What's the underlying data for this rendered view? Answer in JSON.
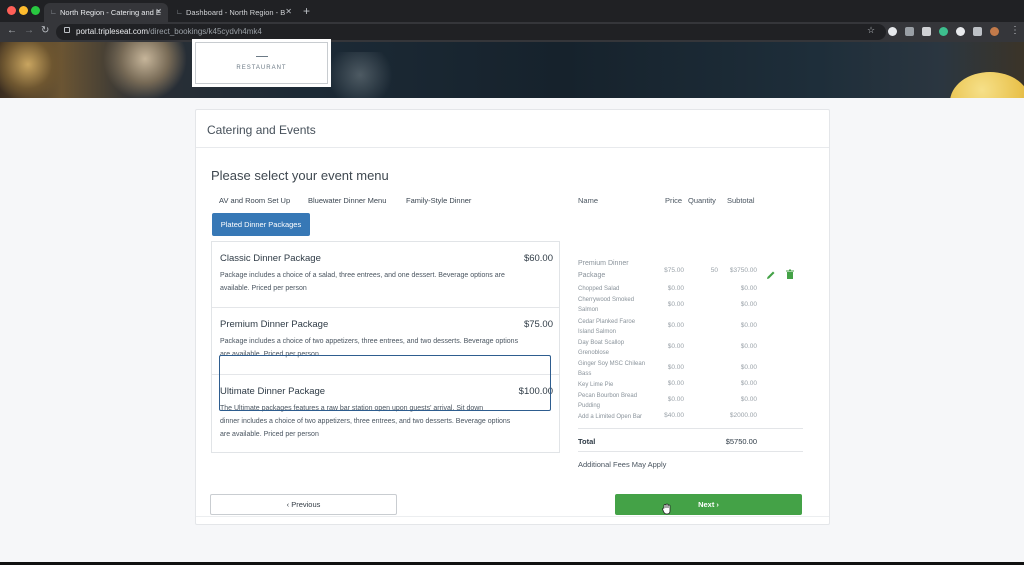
{
  "browser": {
    "tabs": [
      {
        "title": "North Region - Catering and E",
        "active": true
      },
      {
        "title": "Dashboard - North Region - B",
        "active": false
      }
    ],
    "new_tab": "+",
    "url_host": "portal.tripleseat.com",
    "url_path": "/direct_bookings/k45cydvh4mk4"
  },
  "brand": {
    "logo_text": "RESTAURANT"
  },
  "card": {
    "title": "Catering and Events",
    "section_title": "Please select your event menu"
  },
  "categories": [
    {
      "label": "AV and Room Set Up"
    },
    {
      "label": "Bluewater Dinner Menu"
    },
    {
      "label": "Family-Style Dinner"
    },
    {
      "label": "Plated Dinner Packages",
      "active": true
    }
  ],
  "packages": [
    {
      "name": "Classic Dinner Package",
      "price": "$60.00",
      "desc1": "Package includes a choice of a salad, three entrees, and one dessert. Beverage options are",
      "desc2": "available. Priced per person",
      "desc3": "",
      "selected": false
    },
    {
      "name": "Premium Dinner Package",
      "price": "$75.00",
      "desc1": "Package includes a choice of two appetizers, three entrees, and two desserts. Beverage options",
      "desc2": "are available. Priced per person",
      "desc3": "",
      "selected": true
    },
    {
      "name": "Ultimate Dinner Package",
      "price": "$100.00",
      "desc1": "The Ultimate packages features a raw bar station open upon guests' arrival. Sit down",
      "desc2": "dinner includes a choice of two appetizers, three entrees, and two desserts. Beverage options",
      "desc3": "are available. Priced per person",
      "selected": false
    }
  ],
  "summary": {
    "headers": {
      "name": "Name",
      "price": "Price",
      "quantity": "Quantity",
      "subtotal": "Subtotal"
    },
    "rows": [
      {
        "name1": "Premium Dinner",
        "name2": "Package",
        "price": "$75.00",
        "qty": "50",
        "subtotal": "$3750.00"
      },
      {
        "name1": "Chopped Salad",
        "name2": "",
        "price": "$0.00",
        "qty": "",
        "subtotal": "$0.00"
      },
      {
        "name1": "Cherrywood Smoked",
        "name2": "Salmon",
        "price": "$0.00",
        "qty": "",
        "subtotal": "$0.00"
      },
      {
        "name1": "Cedar Planked Faroe",
        "name2": "Island Salmon",
        "price": "$0.00",
        "qty": "",
        "subtotal": "$0.00"
      },
      {
        "name1": "Day Boat Scallop",
        "name2": "Grenoblose",
        "price": "$0.00",
        "qty": "",
        "subtotal": "$0.00"
      },
      {
        "name1": "Ginger Soy MSC Chilean",
        "name2": "Bass",
        "price": "$0.00",
        "qty": "",
        "subtotal": "$0.00"
      },
      {
        "name1": "Key Lime Pie",
        "name2": "",
        "price": "$0.00",
        "qty": "",
        "subtotal": "$0.00"
      },
      {
        "name1": "Pecan Bourbon Bread",
        "name2": "Pudding",
        "price": "$0.00",
        "qty": "",
        "subtotal": "$0.00"
      },
      {
        "name1": "Add a Limited Open Bar",
        "name2": "",
        "price": "$40.00",
        "qty": "",
        "subtotal": "$2000.00"
      }
    ],
    "total_label": "Total",
    "total_value": "$5750.00",
    "fees_note": "Additional Fees May Apply"
  },
  "buttons": {
    "previous": "‹ Previous",
    "next": "Next ›"
  },
  "colors": {
    "primary": "#3778b6",
    "success": "#44a247",
    "selected_border": "#2e5d8f"
  }
}
